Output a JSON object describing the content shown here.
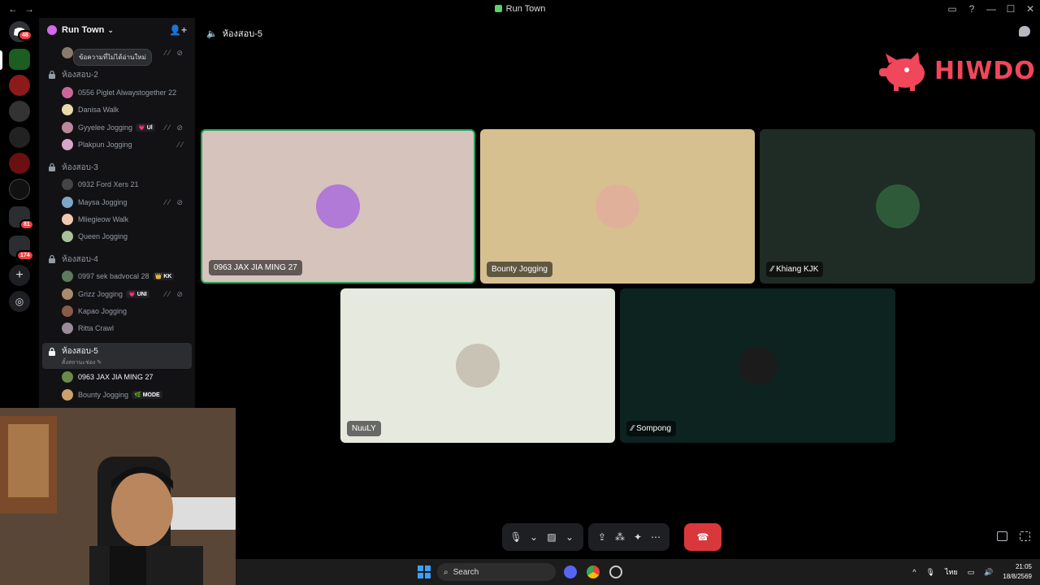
{
  "window": {
    "title": "Run Town",
    "back": "←",
    "forward": "→",
    "controls": [
      "▭",
      "?",
      "—",
      "☐",
      "✕"
    ]
  },
  "servers": {
    "dm_badge": "48",
    "badge2": "81",
    "badge3": "174"
  },
  "sidebar": {
    "guild_name": "Run Town",
    "tooltip": "ข้อความที่ไม่ได้อ่านใหม่",
    "channels": [
      {
        "name": "ห้องสอบ-2",
        "users": [
          {
            "name": "0556 Piglet Alwaystogether 22"
          },
          {
            "name": "Danisa Walk"
          },
          {
            "name": "Gyyelee Jogging",
            "tag": "💗 Ul"
          },
          {
            "name": "Plakpun Jogging"
          }
        ]
      },
      {
        "name": "ห้องสอบ-3",
        "users": [
          {
            "name": "0932 Ford Xers 21"
          },
          {
            "name": "Maysa Jogging"
          },
          {
            "name": "Mliegieow Walk"
          },
          {
            "name": "Queen Jogging"
          }
        ]
      },
      {
        "name": "ห้องสอบ-4",
        "users": [
          {
            "name": "0997 sek badvocal 28",
            "tag": "👑 KK"
          },
          {
            "name": "Grizz Jogging",
            "tag": "💗 UNI"
          },
          {
            "name": "Kapao Jogging"
          },
          {
            "name": "Ritta Crawl"
          }
        ]
      },
      {
        "name": "ห้องสอบ-5",
        "status": "ตั้งสถานะช่อง",
        "users": [
          {
            "name": "0963 JAX JIA MING 27"
          },
          {
            "name": "Bounty Jogging",
            "tag": "🌿 MODE"
          }
        ]
      }
    ]
  },
  "voice": {
    "channel_name": "ห้องสอบ-5",
    "brand": "HIWDO",
    "tiles": [
      {
        "name": "0963 JAX JIA MING 27",
        "bg": "#d6c3bb",
        "speaking": true
      },
      {
        "name": "Bounty Jogging",
        "bg": "#d6c08f"
      },
      {
        "name": "Khiang KJK",
        "bg": "#1f2b25",
        "muted": true
      },
      {
        "name": "NuuLY",
        "bg": "#e6e9dd"
      },
      {
        "name": "Sompong",
        "bg": "#0c2320",
        "muted": true
      }
    ],
    "controls": {
      "mic": "🎙",
      "cam": "▨",
      "share": "⇪",
      "activity": "⁂",
      "soundboard": "✦",
      "more": "⋯",
      "hangup": "☎",
      "chevron": "⌄"
    }
  },
  "taskbar": {
    "search_placeholder": "Search",
    "clock_time": "21:05",
    "clock_date": "18/8/2569",
    "lang": "ไทย",
    "tray_icons": [
      "^",
      "🎙",
      "▭",
      "🔊"
    ]
  }
}
